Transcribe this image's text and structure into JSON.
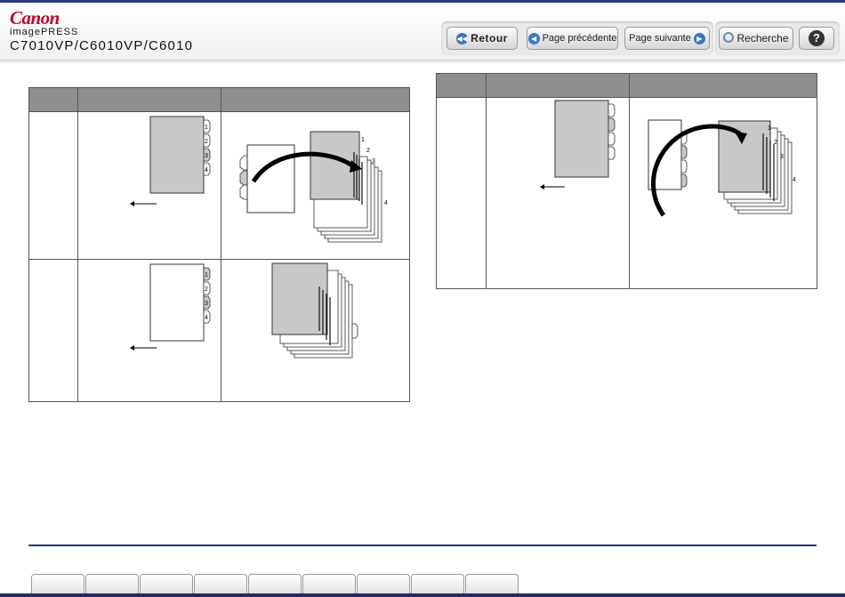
{
  "header": {
    "logo": "Canon",
    "product": "imagePRESS",
    "model": "C7010VP/C6010VP/C6010"
  },
  "nav": {
    "back_label": "Retour",
    "prev_label": "Page précédente",
    "next_label": "Page suivante",
    "search_label": "Recherche",
    "help_label": "?"
  },
  "tables": {
    "left": {
      "rows": [
        {
          "original_tabs": [
            "1",
            "2",
            "3",
            "4"
          ],
          "output_tabs": [
            "1",
            "2",
            "3",
            "4"
          ]
        },
        {
          "original_tabs": [
            "1",
            "2",
            "3",
            "4"
          ],
          "output_tabs": []
        }
      ]
    },
    "right": {
      "rows": [
        {
          "original_tabs": [],
          "output_tabs": [
            "1",
            "2",
            "3",
            "4"
          ]
        }
      ]
    }
  },
  "footer": {
    "tab_count": 9
  }
}
